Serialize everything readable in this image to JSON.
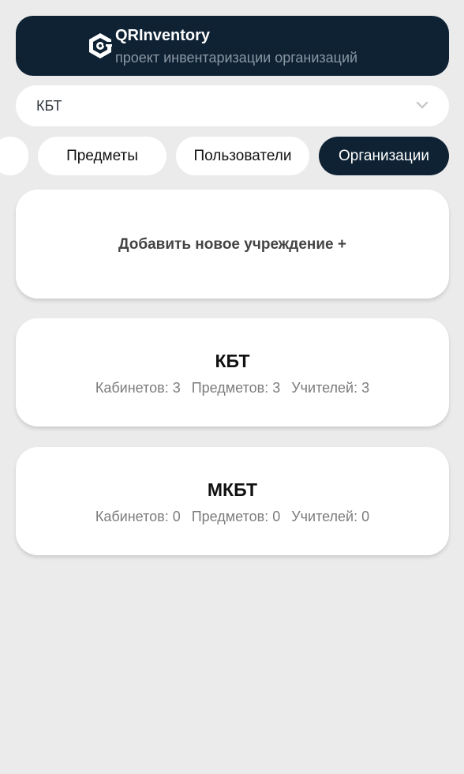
{
  "header": {
    "title": "QRInventory",
    "subtitle": "проект инвентаризации организаций",
    "logo_icon": "qr-gear-logo-icon"
  },
  "select": {
    "value": "КБТ",
    "icon": "chevron-down-icon"
  },
  "tabs": [
    {
      "label": "",
      "active": false
    },
    {
      "label": "Предметы",
      "active": false
    },
    {
      "label": "Пользователи",
      "active": false
    },
    {
      "label": "Организации",
      "active": true
    }
  ],
  "add_card": {
    "label": "Добавить новое учреждение +"
  },
  "organizations": [
    {
      "name": "КБТ",
      "stats": [
        "Кабинетов: 3",
        "Предметов: 3",
        "Учителей: 3"
      ]
    },
    {
      "name": "МКБТ",
      "stats": [
        "Кабинетов: 0",
        "Предметов: 0",
        "Учителей: 0"
      ]
    }
  ],
  "colors": {
    "background": "#ebebeb",
    "accent_dark": "#0e2234",
    "card": "#ffffff",
    "muted_text": "#7c7c7c"
  }
}
